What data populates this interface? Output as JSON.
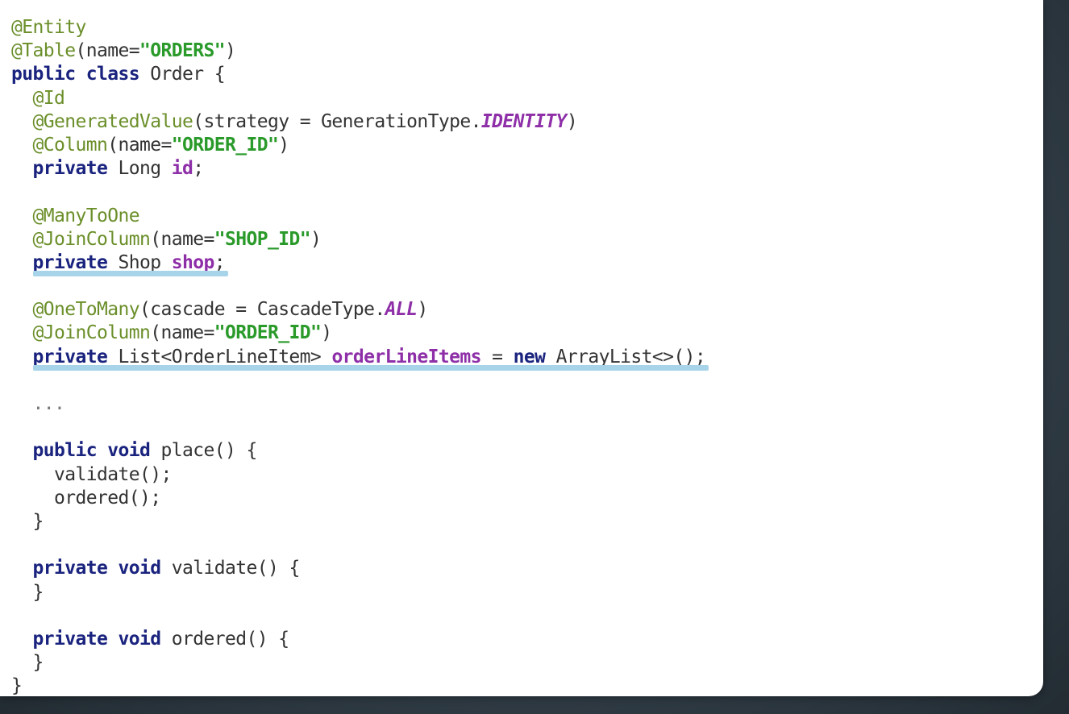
{
  "code": {
    "lines": [
      [
        {
          "t": "@Entity",
          "c": "ann"
        }
      ],
      [
        {
          "t": "@Table",
          "c": "ann"
        },
        {
          "t": "(name=",
          "c": ""
        },
        {
          "t": "\"ORDERS\"",
          "c": "str"
        },
        {
          "t": ")",
          "c": ""
        }
      ],
      [
        {
          "t": "public",
          "c": "kw"
        },
        {
          "t": " ",
          "c": ""
        },
        {
          "t": "class",
          "c": "kw"
        },
        {
          "t": " Order {",
          "c": ""
        }
      ],
      [
        {
          "t": "  ",
          "c": ""
        },
        {
          "t": "@Id",
          "c": "ann"
        }
      ],
      [
        {
          "t": "  ",
          "c": ""
        },
        {
          "t": "@GeneratedValue",
          "c": "ann"
        },
        {
          "t": "(strategy = GenerationType.",
          "c": ""
        },
        {
          "t": "IDENTITY",
          "c": "cst"
        },
        {
          "t": ")",
          "c": ""
        }
      ],
      [
        {
          "t": "  ",
          "c": ""
        },
        {
          "t": "@Column",
          "c": "ann"
        },
        {
          "t": "(name=",
          "c": ""
        },
        {
          "t": "\"ORDER_ID\"",
          "c": "str"
        },
        {
          "t": ")",
          "c": ""
        }
      ],
      [
        {
          "t": "  ",
          "c": ""
        },
        {
          "t": "private",
          "c": "kw"
        },
        {
          "t": " Long ",
          "c": ""
        },
        {
          "t": "id",
          "c": "fld"
        },
        {
          "t": ";",
          "c": ""
        }
      ],
      [],
      [
        {
          "t": "  ",
          "c": ""
        },
        {
          "t": "@ManyToOne",
          "c": "ann"
        }
      ],
      [
        {
          "t": "  ",
          "c": ""
        },
        {
          "t": "@JoinColumn",
          "c": "ann"
        },
        {
          "t": "(name=",
          "c": ""
        },
        {
          "t": "\"SHOP_ID\"",
          "c": "str"
        },
        {
          "t": ")",
          "c": ""
        }
      ],
      [
        {
          "t": "  ",
          "c": ""
        },
        {
          "t": "private",
          "c": "kw"
        },
        {
          "t": " Shop ",
          "c": ""
        },
        {
          "t": "shop",
          "c": "fld"
        },
        {
          "t": ";",
          "c": ""
        }
      ],
      [],
      [
        {
          "t": "  ",
          "c": ""
        },
        {
          "t": "@OneToMany",
          "c": "ann"
        },
        {
          "t": "(cascade = CascadeType.",
          "c": ""
        },
        {
          "t": "ALL",
          "c": "cst"
        },
        {
          "t": ")",
          "c": ""
        }
      ],
      [
        {
          "t": "  ",
          "c": ""
        },
        {
          "t": "@JoinColumn",
          "c": "ann"
        },
        {
          "t": "(name=",
          "c": ""
        },
        {
          "t": "\"ORDER_ID\"",
          "c": "str"
        },
        {
          "t": ")",
          "c": ""
        }
      ],
      [
        {
          "t": "  ",
          "c": ""
        },
        {
          "t": "private",
          "c": "kw"
        },
        {
          "t": " List<OrderLineItem> ",
          "c": ""
        },
        {
          "t": "orderLineItems",
          "c": "fld"
        },
        {
          "t": " = ",
          "c": ""
        },
        {
          "t": "new",
          "c": "kw"
        },
        {
          "t": " ArrayList<>();",
          "c": ""
        }
      ],
      [],
      [
        {
          "t": "  ...",
          "c": "dots"
        }
      ],
      [],
      [
        {
          "t": "  ",
          "c": ""
        },
        {
          "t": "public",
          "c": "kw"
        },
        {
          "t": " ",
          "c": ""
        },
        {
          "t": "void",
          "c": "kw"
        },
        {
          "t": " place() {",
          "c": ""
        }
      ],
      [
        {
          "t": "    validate();",
          "c": ""
        }
      ],
      [
        {
          "t": "    ordered();",
          "c": ""
        }
      ],
      [
        {
          "t": "  }",
          "c": ""
        }
      ],
      [],
      [
        {
          "t": "  ",
          "c": ""
        },
        {
          "t": "private",
          "c": "kw"
        },
        {
          "t": " ",
          "c": ""
        },
        {
          "t": "void",
          "c": "kw"
        },
        {
          "t": " validate() {",
          "c": ""
        }
      ],
      [
        {
          "t": "  }",
          "c": ""
        }
      ],
      [],
      [
        {
          "t": "  ",
          "c": ""
        },
        {
          "t": "private",
          "c": "kw"
        },
        {
          "t": " ",
          "c": ""
        },
        {
          "t": "void",
          "c": "kw"
        },
        {
          "t": " ordered() {",
          "c": ""
        }
      ],
      [
        {
          "t": "  }",
          "c": ""
        }
      ],
      [
        {
          "t": "}",
          "c": ""
        }
      ]
    ],
    "highlighted_lines": [
      10,
      14
    ]
  },
  "colors": {
    "annotation": "#6b8f2a",
    "string": "#2a9a2a",
    "keyword": "#1a237e",
    "constant": "#8e2fa8",
    "highlight": "#a8d4ea"
  }
}
